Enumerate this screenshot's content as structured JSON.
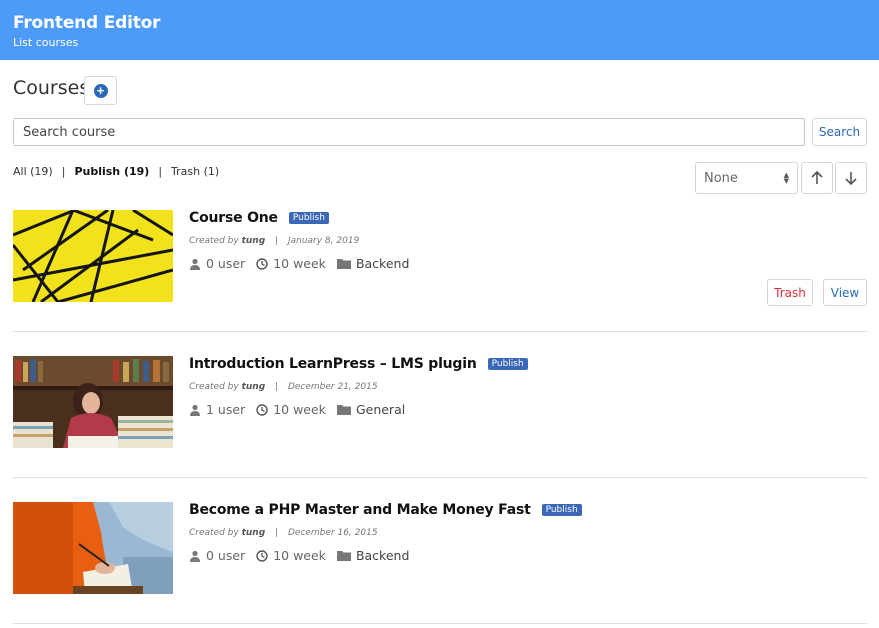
{
  "header": {
    "title": "Frontend Editor",
    "subtitle": "List courses"
  },
  "page": {
    "title": "Courses"
  },
  "search": {
    "placeholder": "Search course",
    "button_label": "Search"
  },
  "filters": [
    {
      "label": "All (19)"
    },
    {
      "label": "Publish (19)"
    },
    {
      "label": "Trash (1)"
    }
  ],
  "sort": {
    "selected": "None"
  },
  "courses": [
    {
      "title": "Course One",
      "status": "Publish",
      "created_by_label": "Created by",
      "author": "tung",
      "date": "January 8, 2019",
      "users": "0 user",
      "duration": "10 week",
      "category": "Backend"
    },
    {
      "title": "Introduction LearnPress – LMS plugin",
      "status": "Publish",
      "created_by_label": "Created by",
      "author": "tung",
      "date": "December 21, 2015",
      "users": "1 user",
      "duration": "10 week",
      "category": "General"
    },
    {
      "title": "Become a PHP Master and Make Money Fast",
      "status": "Publish",
      "created_by_label": "Created by",
      "author": "tung",
      "date": "December 16, 2015",
      "users": "0 user",
      "duration": "10 week",
      "category": "Backend"
    }
  ],
  "actions": {
    "trash_label": "Trash",
    "view_label": "View"
  },
  "colors": {
    "header": "#4d9bf9",
    "badge": "#3a67b8",
    "link": "#2b6ab7",
    "danger": "#e0303d"
  }
}
